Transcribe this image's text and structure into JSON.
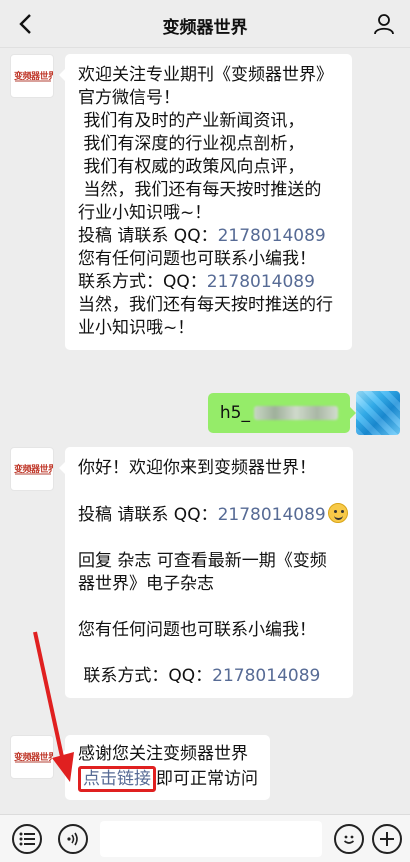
{
  "header": {
    "title": "变频器世界"
  },
  "avatars": {
    "account_logo_text": "变频器世界"
  },
  "messages": {
    "welcome": {
      "lines": [
        "欢迎关注专业期刊《变频器世界》",
        "官方微信号！",
        " 我们有及时的产业新闻资讯，",
        " 我们有深度的行业视点剖析，",
        " 我们有权威的政策风向点评，",
        " 当然，我们还有每天按时推送的",
        "行业小知识哦~！"
      ],
      "contrib_label": "投稿 请联系 QQ：",
      "contrib_qq": "2178014089",
      "any_question": "您有任何问题也可联系小编我！",
      "contact_label": "联系方式：QQ：",
      "contact_qq": "2178014089",
      "tail_1": "当然，我们还有每天按时推送的行",
      "tail_2": "业小知识哦~！"
    },
    "user": {
      "prefix": "h5_"
    },
    "hello": {
      "greeting": "你好！欢迎你来到变频器世界！",
      "contrib_label": "投稿 请联系 QQ：",
      "contrib_qq": "2178014089",
      "reply_1": "回复 杂志 可查看最新一期《变频",
      "reply_2": "器世界》电子杂志",
      "any_question": "您有任何问题也可联系小编我！",
      "contact_label": " 联系方式：QQ：",
      "contact_qq": "2178014089"
    },
    "thanks": {
      "line1": "感谢您关注变频器世界",
      "link_text": "点击链接",
      "after_link": "即可正常访问"
    }
  },
  "icons": {
    "back": "chevron-left-icon",
    "profile": "person-icon",
    "menu": "list-menu-icon",
    "voice": "voice-icon",
    "emoji": "emoji-smile-icon",
    "plus": "plus-icon"
  },
  "colors": {
    "background": "#ededed",
    "link": "#576b95",
    "my_bubble": "#95ec69",
    "highlight": "#e02020"
  }
}
